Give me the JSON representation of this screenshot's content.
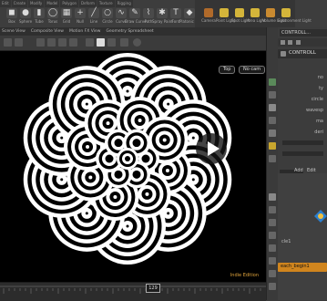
{
  "shelf": {
    "tabs": [
      "Edit",
      "Create",
      "Modify",
      "Model",
      "Polygon",
      "Deform",
      "Texture",
      "Rigging"
    ],
    "tools": [
      {
        "icon": "box-icon",
        "label": "Box"
      },
      {
        "icon": "sphere-icon",
        "label": "Sphere"
      },
      {
        "icon": "tube-icon",
        "label": "Tube"
      },
      {
        "icon": "torus-icon",
        "label": "Torus"
      },
      {
        "icon": "grid-icon",
        "label": "Grid"
      },
      {
        "icon": "null-icon",
        "label": "Null"
      },
      {
        "icon": "line-icon",
        "label": "Line"
      },
      {
        "icon": "circle-icon",
        "label": "Circle"
      },
      {
        "icon": "curve-icon",
        "label": "Curve"
      },
      {
        "icon": "draw-curve-icon",
        "label": "Draw Curve"
      },
      {
        "icon": "path-icon",
        "label": "Path"
      },
      {
        "icon": "spray-paint-icon",
        "label": "Spray Paint"
      },
      {
        "icon": "text-icon",
        "label": "Font"
      },
      {
        "icon": "platonic-icon",
        "label": "Platonic Solids"
      }
    ],
    "right_tools": [
      {
        "icon": "camera-icon",
        "label": "Camera"
      },
      {
        "icon": "point-light-icon",
        "label": "Point Light"
      },
      {
        "icon": "spot-light-icon",
        "label": "Spot Light"
      },
      {
        "icon": "area-light-icon",
        "label": "Area Light"
      },
      {
        "icon": "volume-light-icon",
        "label": "Volume Light"
      },
      {
        "icon": "env-light-icon",
        "label": "Environment Light"
      }
    ]
  },
  "pane_tabs": [
    "Scene View",
    "Composite View",
    "Motion FX View",
    "Geometry Spreadsheet"
  ],
  "viewport": {
    "camera_menu": "Top",
    "camera_name": "No cam",
    "edition": "Indie Edition"
  },
  "timeline": {
    "current_frame": "129"
  },
  "params": {
    "path": "CONTROLL...",
    "node_name": "CONTROLL",
    "labels": [
      "no",
      "ty",
      "circle",
      "wavesp",
      "ma",
      "deri"
    ],
    "secondary_labels": [
      "Add",
      "Edit"
    ],
    "nodes": [
      "Add",
      "Edit"
    ],
    "network_label": "cle1",
    "bottom_node": "each_begin1"
  },
  "colors": {
    "accent": "#e0a43c",
    "viewport_bg": "#000000",
    "pattern_fg": "#ffffff"
  }
}
